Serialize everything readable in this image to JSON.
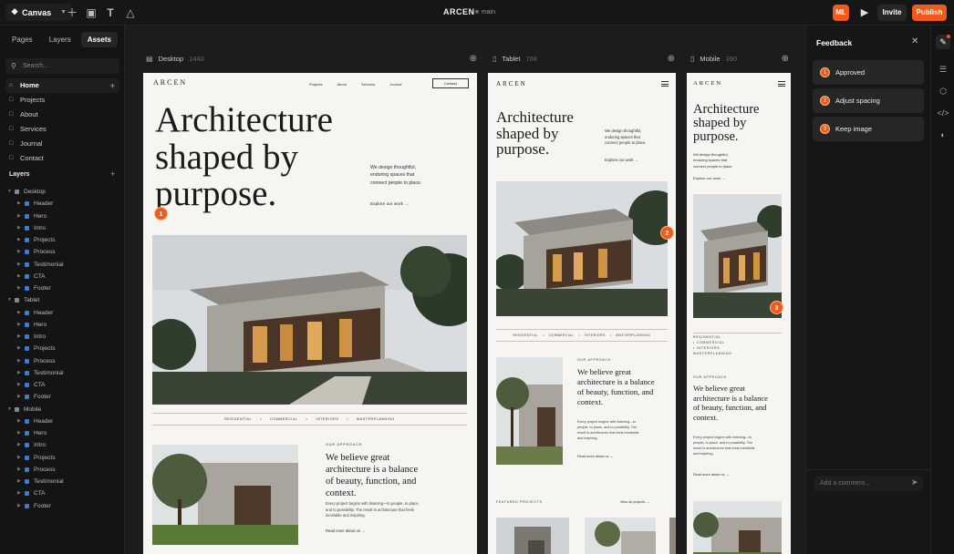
{
  "topbar": {
    "app_name": "Canvas",
    "project": "ARCEN",
    "branch": "main",
    "avatar": "ML",
    "invite": "Invite",
    "publish": "Publish",
    "icons": [
      "plus-icon",
      "frame-icon",
      "text-icon",
      "warning-icon",
      "play-icon"
    ]
  },
  "left": {
    "tabs": [
      "Pages",
      "Layers",
      "Assets"
    ],
    "active_tab": "Assets",
    "search_placeholder": "Search...",
    "pages": [
      "Home",
      "Projects",
      "About",
      "Services",
      "Journal",
      "Contact"
    ],
    "layers_heading": "Layers",
    "tree": [
      {
        "name": "Desktop",
        "frame": true,
        "children": [
          "Header",
          "Hero",
          "Intro",
          "Projects",
          "Process",
          "Testimonial",
          "CTA",
          "Footer"
        ]
      },
      {
        "name": "Tablet",
        "frame": true,
        "children": [
          "Header",
          "Hero",
          "Intro",
          "Projects",
          "Process",
          "Testimonial",
          "CTA",
          "Footer"
        ]
      },
      {
        "name": "Mobile",
        "frame": true,
        "children": [
          "Header",
          "Hero",
          "Intro",
          "Projects",
          "Process",
          "Testimonial",
          "CTA",
          "Footer"
        ]
      }
    ]
  },
  "frames": {
    "desktop": {
      "name": "Desktop",
      "width": "1440"
    },
    "tablet": {
      "name": "Tablet",
      "width": "768"
    },
    "mobile": {
      "name": "Mobile",
      "width": "390"
    }
  },
  "site": {
    "brand": "ARCEN",
    "nav": [
      "Projects",
      "About",
      "Services",
      "Journal"
    ],
    "contact": "Contact",
    "hero_lines": [
      "Architecture",
      "shaped by",
      "purpose."
    ],
    "hero_lines_tablet": [
      "Architecture",
      "shaped by",
      "purpose."
    ],
    "hero_lines_mobile": [
      "Architecture",
      "shaped by",
      "purpose."
    ],
    "intro": "We design thoughtful, enduring spaces that connect people to place.",
    "intro_lines": [
      "We design thoughtful,",
      "enduring spaces that",
      "connect people to place."
    ],
    "explore": "Explore our work",
    "categories": [
      "RESIDENTIAL",
      "COMMERCIAL",
      "INTERIORS",
      "MASTERPLANNING"
    ],
    "approach_label": "OUR APPROACH",
    "approach_lines_desktop": [
      "We believe great",
      "architecture is a balance",
      "of beauty, function, and",
      "context."
    ],
    "approach_lines_tablet": [
      "We believe great",
      "architecture is a balance",
      "of beauty, function, and",
      "context."
    ],
    "approach_lines_mobile": [
      "We believe great",
      "architecture is a balance",
      "of beauty, function, and",
      "context."
    ],
    "approach_body_desktop": [
      "Every project begins with listening—to people, to place,",
      "and to possibility. The result is architecture that feels",
      "inevitable and inspiring."
    ],
    "approach_body_tablet": [
      "Every project begins with listening—to",
      "people, to place, and to possibility. The",
      "result is architecture that feels inevitable",
      "and inspiring."
    ],
    "approach_body_mobile": [
      "Every project begins with listening—to",
      "people, to place, and to possibility. The",
      "result is architecture that feels inevitable",
      "and inspiring."
    ],
    "read_more": "Read more about us",
    "featured_label": "FEATURED PROJECTS",
    "view_all": "View all projects"
  },
  "pins": [
    "1",
    "2",
    "3"
  ],
  "feedback": {
    "title": "Feedback",
    "items": [
      {
        "num": "1",
        "text": "Approved"
      },
      {
        "num": "2",
        "text": "Adjust spacing"
      },
      {
        "num": "3",
        "text": "Keep image"
      }
    ],
    "comment_placeholder": "Add a comment..."
  },
  "colors": {
    "accent": "#f05a1a",
    "panel": "#161616",
    "canvas": "#1c1c1c",
    "page": "#f7f5f1"
  }
}
